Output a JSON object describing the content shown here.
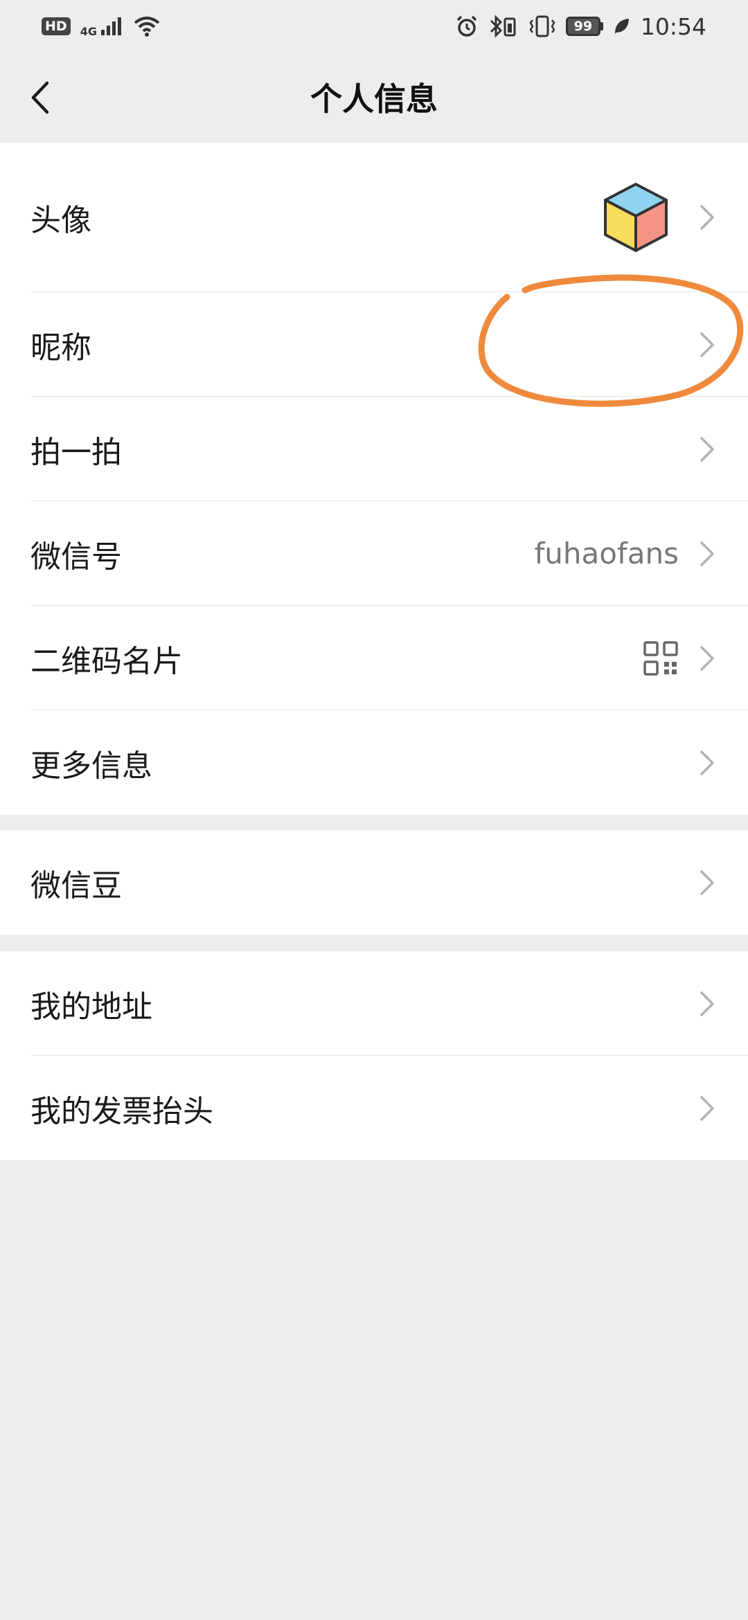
{
  "status_bar": {
    "hd": "HD",
    "network": "4G",
    "battery": "99",
    "time": "10:54"
  },
  "nav": {
    "title": "个人信息",
    "back_icon": "chevron-left-icon"
  },
  "rows": {
    "avatar": {
      "label": "头像"
    },
    "nickname": {
      "label": "昵称",
      "value": ""
    },
    "pat": {
      "label": "拍一拍"
    },
    "wechat_id": {
      "label": "微信号",
      "value": "fuhaofans"
    },
    "qr_code": {
      "label": "二维码名片"
    },
    "more_info": {
      "label": "更多信息"
    },
    "wechat_beans": {
      "label": "微信豆"
    },
    "my_address": {
      "label": "我的地址"
    },
    "invoice_title": {
      "label": "我的发票抬头"
    }
  },
  "colors": {
    "background": "#ededed",
    "card": "#ffffff",
    "annotation": "#ef8a3c",
    "chevron": "#b2b2b2"
  }
}
